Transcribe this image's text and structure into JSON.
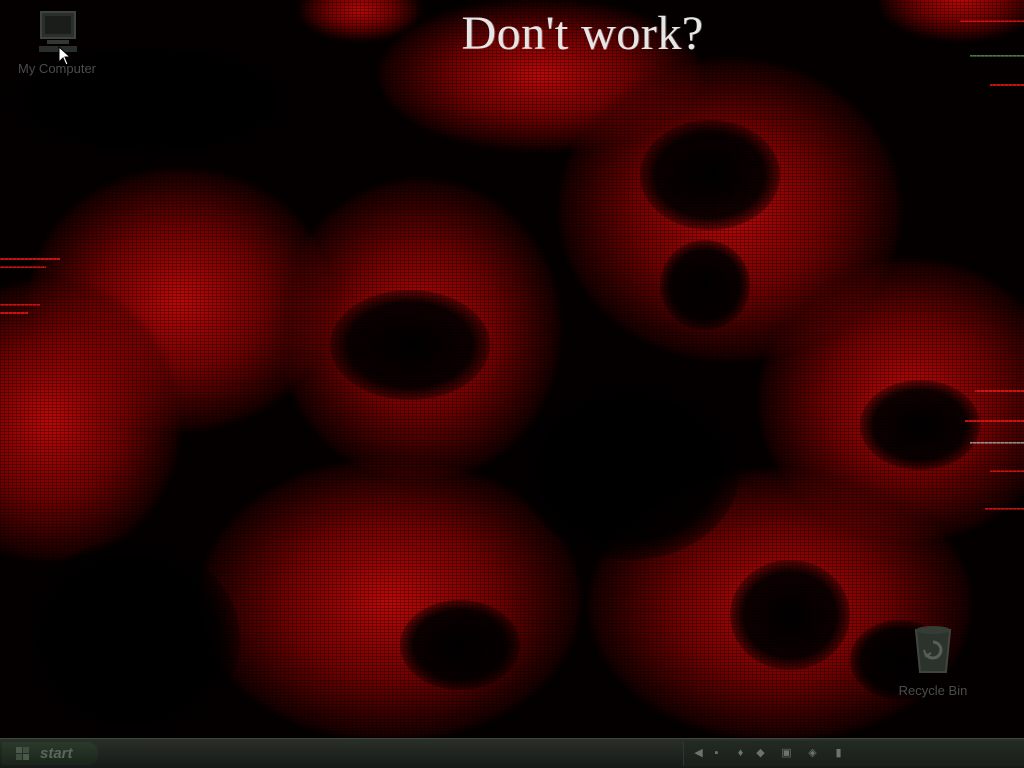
{
  "screen": {
    "message": "Don't work?"
  },
  "desktop_icons": {
    "my_computer": {
      "label": "My Computer",
      "icon": "computer-icon"
    },
    "recycle_bin": {
      "label": "Recycle Bin",
      "icon": "recycle-bin-icon"
    }
  },
  "taskbar": {
    "start_label": "start",
    "tray_icons": [
      "speaker-icon",
      "network-icon",
      "volume-icon",
      "security-icon",
      "update-icon",
      "sync-icon",
      "power-icon"
    ],
    "clock": ""
  },
  "colors": {
    "wallpaper_red": "#c00808",
    "background": "#000000",
    "message_text": "#e6e6e6",
    "taskbar": "#1c211c"
  }
}
